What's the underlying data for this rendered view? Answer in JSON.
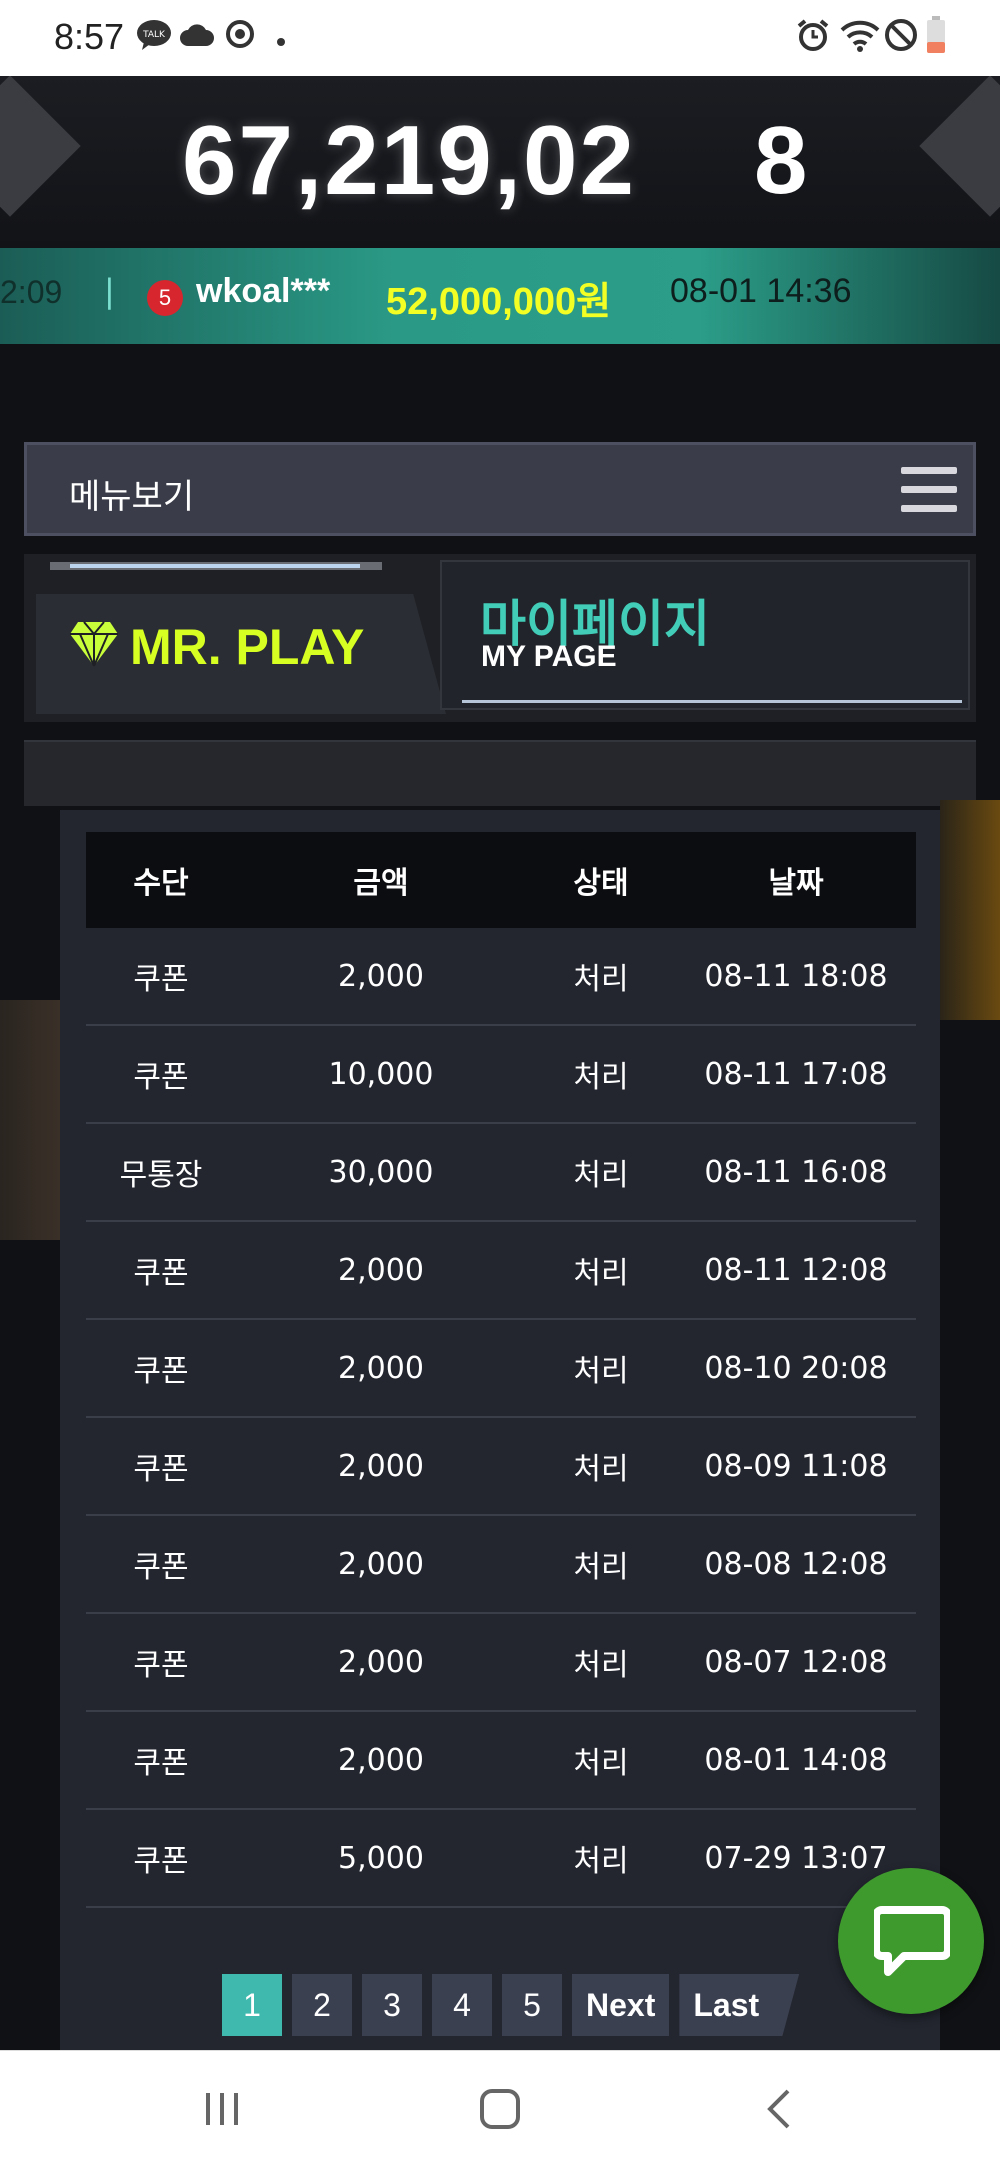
{
  "status_bar": {
    "time": "8:57",
    "icons": [
      "kakaotalk-icon",
      "cloud-icon",
      "sync-icon",
      "dot-icon",
      "alarm-icon",
      "wifi-icon",
      "do-not-disturb-icon",
      "battery-icon"
    ]
  },
  "hero": {
    "jackpot_amount": "67,219,02",
    "rolling_digits": "8"
  },
  "ticker": {
    "prev_time": "2:09",
    "rank": "5",
    "user": "wkoal***",
    "amount": "52,000,000원",
    "datetime": "08-01 14:36"
  },
  "menu": {
    "label": "메뉴보기"
  },
  "header": {
    "logo_text": "MR. PLAY",
    "title_ko": "마이페이지",
    "title_en": "MY PAGE"
  },
  "table": {
    "columns": [
      "수단",
      "금액",
      "상태",
      "날짜"
    ],
    "rows": [
      {
        "method": "쿠폰",
        "amount": "2,000",
        "status": "처리",
        "date": "08-11 18:08"
      },
      {
        "method": "쿠폰",
        "amount": "10,000",
        "status": "처리",
        "date": "08-11 17:08"
      },
      {
        "method": "무통장",
        "amount": "30,000",
        "status": "처리",
        "date": "08-11 16:08"
      },
      {
        "method": "쿠폰",
        "amount": "2,000",
        "status": "처리",
        "date": "08-11 12:08"
      },
      {
        "method": "쿠폰",
        "amount": "2,000",
        "status": "처리",
        "date": "08-10 20:08"
      },
      {
        "method": "쿠폰",
        "amount": "2,000",
        "status": "처리",
        "date": "08-09 11:08"
      },
      {
        "method": "쿠폰",
        "amount": "2,000",
        "status": "처리",
        "date": "08-08 12:08"
      },
      {
        "method": "쿠폰",
        "amount": "2,000",
        "status": "처리",
        "date": "08-07 12:08"
      },
      {
        "method": "쿠폰",
        "amount": "2,000",
        "status": "처리",
        "date": "08-01 14:08"
      },
      {
        "method": "쿠폰",
        "amount": "5,000",
        "status": "처리",
        "date": "07-29 13:07"
      }
    ]
  },
  "pagination": {
    "pages": [
      "1",
      "2",
      "3",
      "4",
      "5"
    ],
    "active_page": "1",
    "next_label": "Next",
    "last_label": "Last"
  },
  "colors": {
    "accent_teal": "#3fb9ad",
    "logo_yellow": "#d8ff22",
    "ticker_amount": "#f3ff24",
    "chat_green": "#3f9a2e"
  }
}
